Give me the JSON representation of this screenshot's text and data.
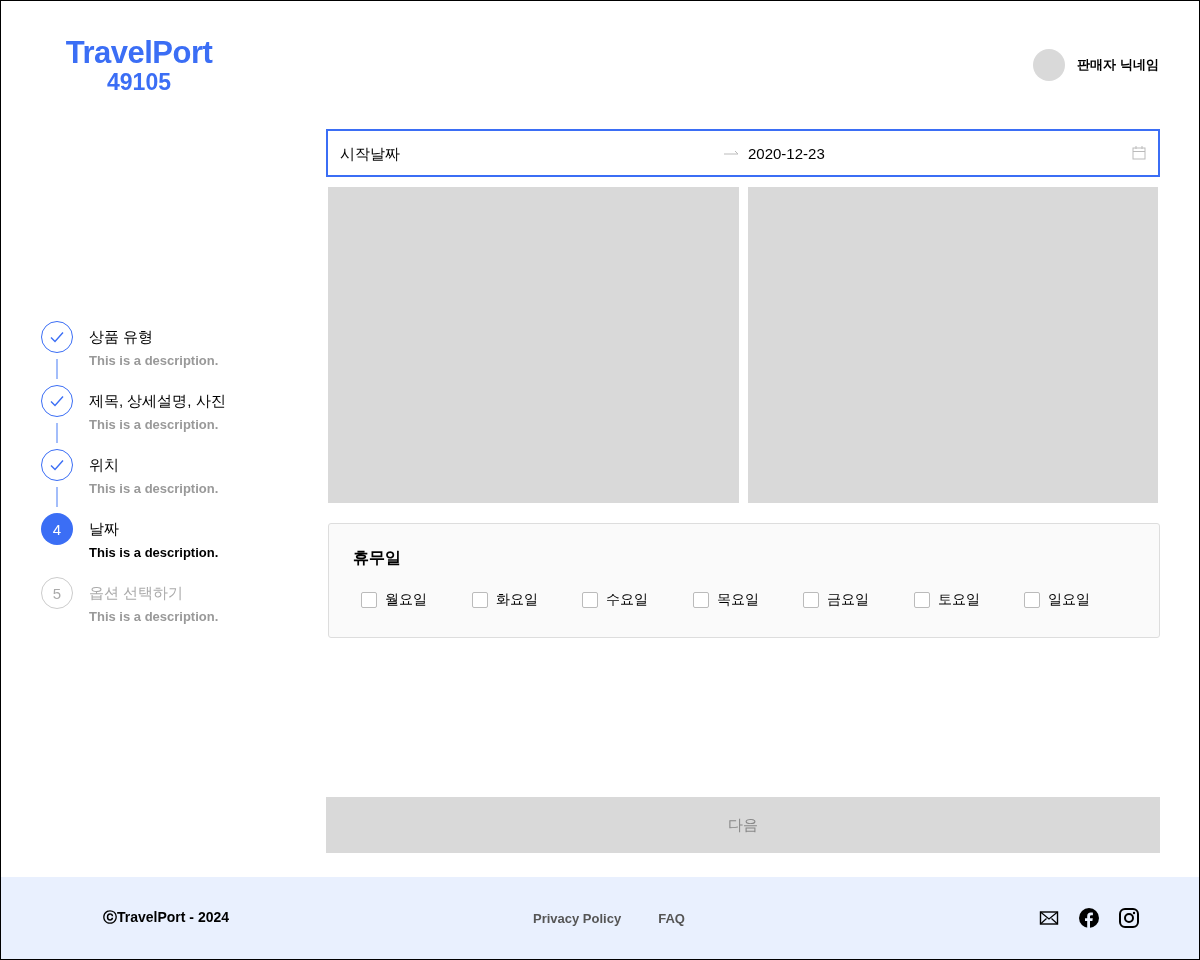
{
  "logo": {
    "name": "TravelPort",
    "code": "49105"
  },
  "user": {
    "name": "판매자 닉네임"
  },
  "steps": [
    {
      "title": "상품 유형",
      "description": "This is a description.",
      "completed": true,
      "selected": false
    },
    {
      "title": "제목, 상세설명, 사진",
      "description": "This is a description.",
      "completed": true,
      "selected": false
    },
    {
      "title": "위치",
      "description": "This is a description.",
      "completed": true,
      "selected": false
    },
    {
      "number": "4",
      "title": "날짜",
      "description": "This is a description.",
      "completed": false,
      "selected": true
    },
    {
      "number": "5",
      "title": "옵션 선택하기",
      "description": "This is a description.",
      "completed": false,
      "selected": false
    }
  ],
  "date_range": {
    "start_placeholder": "시작날짜",
    "end_value": "2020-12-23",
    "focused": true
  },
  "holidays": {
    "title": "휴무일",
    "days": [
      {
        "label": "월요일",
        "checked": false
      },
      {
        "label": "화요일",
        "checked": false
      },
      {
        "label": "수요일",
        "checked": false
      },
      {
        "label": "목요일",
        "checked": false
      },
      {
        "label": "금요일",
        "checked": false
      },
      {
        "label": "토요일",
        "checked": false
      },
      {
        "label": "일요일",
        "checked": false
      }
    ]
  },
  "next_button": {
    "label": "다음",
    "disabled": true
  },
  "footer": {
    "copyright": "ⓒTravelPort - 2024",
    "links": [
      "Privacy Policy",
      "FAQ"
    ]
  }
}
